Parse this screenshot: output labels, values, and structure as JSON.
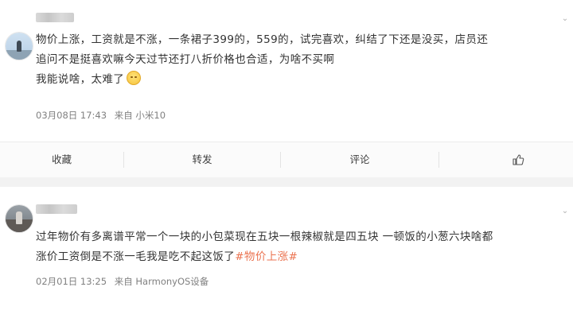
{
  "posts": [
    {
      "content_lines": [
        "物价上涨，工资就是不涨，一条裙子399的，559的，试完喜欢，纠结了下还是没买，店员还",
        "追问不是挺喜欢嘛今天过节还打八折价格也合适，为啥不买啊",
        "我能说啥，太难了"
      ],
      "emoji": "blush-emoji",
      "time": "03月08日 17:43",
      "source": "来自 小米10",
      "actions": {
        "collect": "收藏",
        "repost": "转发",
        "comment": "评论",
        "like_icon": "thumbs-up-icon"
      }
    },
    {
      "content_lines": [
        "过年物价有多离谱平常一个一块的小包菜现在五块一根辣椒就是四五块 一顿饭的小葱六块啥都",
        "涨价工资倒是不涨一毛我是吃不起这饭了"
      ],
      "hashtag": "#物价上涨#",
      "time": "02月01日 13:25",
      "source": "来自 HarmonyOS设备"
    }
  ],
  "colors": {
    "text": "#333333",
    "meta": "#808080",
    "hashtag": "#eb7350",
    "separator": "#f2f2f2"
  }
}
